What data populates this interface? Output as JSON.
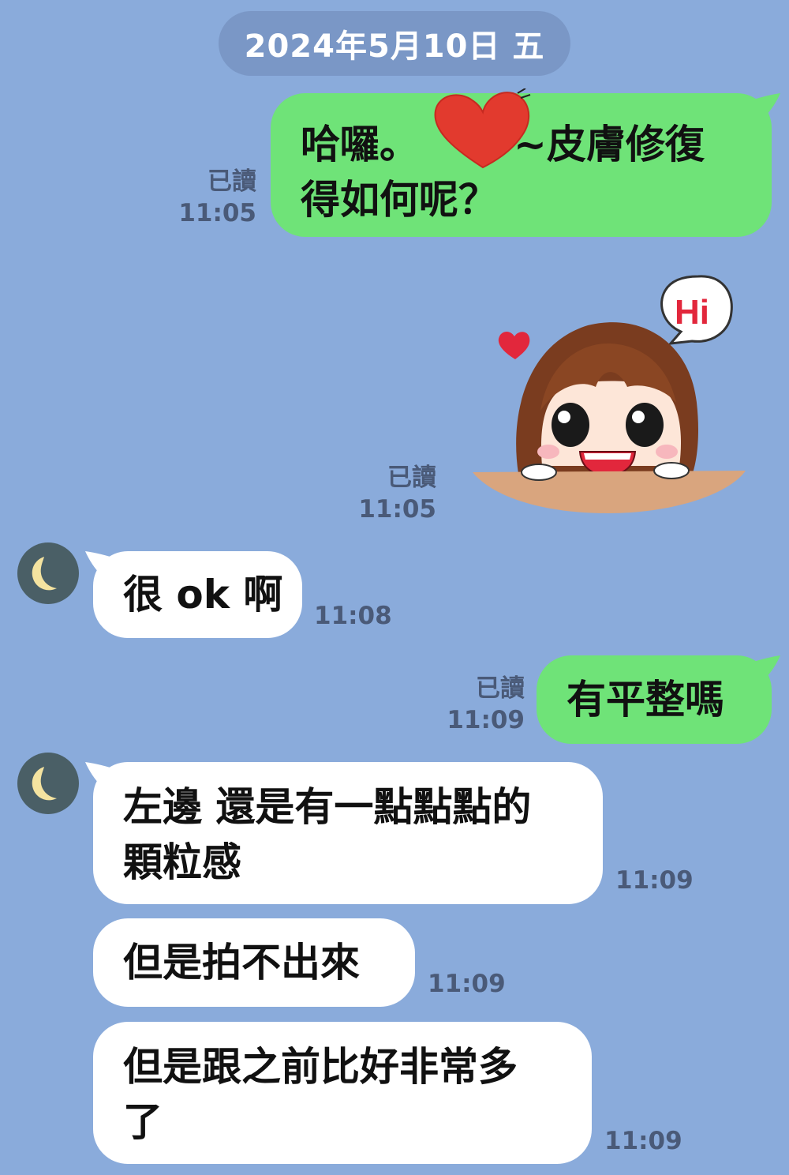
{
  "date_label": "2024年5月10日 五",
  "messages": [
    {
      "text_line1": "哈囉。",
      "text_line1b": "~皮膚修復",
      "text_line2": "得如何呢？",
      "read": "已讀",
      "time": "11:05"
    },
    {
      "sticker_text": "Hi",
      "read": "已讀",
      "time": "11:05"
    },
    {
      "text": "很 ok 啊",
      "time": "11:08"
    },
    {
      "text": "有平整嗎",
      "read": "已讀",
      "time": "11:09"
    },
    {
      "text_line1": "左邊 還是有一點點點的",
      "text_line2": "顆粒感",
      "time": "11:09"
    },
    {
      "text": "但是拍不出來",
      "time": "11:09"
    },
    {
      "text_line1": "但是跟之前比好非常多",
      "text_line2": "了",
      "time": "11:09"
    }
  ],
  "icons": {
    "avatar": "crescent-moon-icon",
    "redaction": "red-heart-icon"
  },
  "colors": {
    "background": "#8aabdb",
    "outgoing": "#6fe378",
    "incoming": "#ffffff",
    "date_pill": "#7a97c6"
  }
}
